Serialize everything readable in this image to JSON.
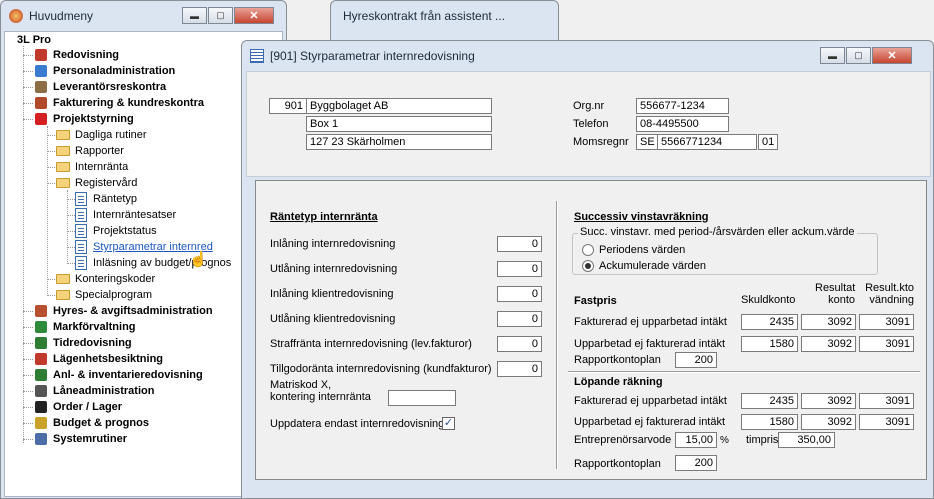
{
  "main_window": {
    "title": "Huvudmeny",
    "min": "▬",
    "max": "▢",
    "close": "✕"
  },
  "back_window": {
    "title": "Hyreskontrakt från assistent ..."
  },
  "tree": {
    "root": "3L Pro",
    "items": [
      {
        "label": "Redovisning",
        "icon": "book-icon",
        "color": "#c0392b"
      },
      {
        "label": "Personaladministration",
        "icon": "people-icon",
        "color": "#3b7ad1"
      },
      {
        "label": "Leverantörsreskontra",
        "icon": "box-icon",
        "color": "#8d6e46"
      },
      {
        "label": "Fakturering & kundreskontra",
        "icon": "cart-icon",
        "color": "#b04a2a"
      },
      {
        "label": "Projektstyrning",
        "icon": "binder-icon",
        "color": "#d42020"
      }
    ],
    "sub": [
      "Dagliga rutiner",
      "Rapporter",
      "Internränta",
      "Registervård"
    ],
    "leaf": [
      "Räntetyp",
      "Internräntesatser",
      "Projektstatus",
      "Styrparametrar internred",
      "Inläsning av budget/prognos"
    ],
    "sub2": [
      "Konteringskoder",
      "Specialprogram"
    ],
    "items2": [
      {
        "label": "Hyres- & avgiftsadministration",
        "icon": "house-icon",
        "color": "#b84f2e"
      },
      {
        "label": "Markförvaltning",
        "icon": "tree-icon",
        "color": "#2e8b3a"
      },
      {
        "label": "Tidredovisning",
        "icon": "clock-icon",
        "color": "#2e7d32"
      },
      {
        "label": "Lägenhetsbesiktning",
        "icon": "clipboard-icon",
        "color": "#c0392b"
      },
      {
        "label": "Anl- & inventarieredovisning",
        "icon": "chart-icon",
        "color": "#2e7d32"
      },
      {
        "label": "Låneadministration",
        "icon": "building-icon",
        "color": "#555"
      },
      {
        "label": "Order / Lager",
        "icon": "barcode-icon",
        "color": "#222"
      },
      {
        "label": "Budget & prognos",
        "icon": "coins-icon",
        "color": "#c9a227"
      },
      {
        "label": "Systemrutiner",
        "icon": "gear-icon",
        "color": "#4b6ea8"
      }
    ]
  },
  "dialog": {
    "title": "[901] Styrparametrar internredovisning",
    "company": {
      "nr": "901",
      "name": "Byggbolaget AB",
      "address": "Box 1",
      "city": "127 23  Skärholmen"
    },
    "org_label": "Org.nr",
    "org": "556677-1234",
    "tel_label": "Telefon",
    "tel": "08-4495500",
    "moms_label": "Momsregnr",
    "moms_cc": "SE",
    "moms_nr": "5566771234",
    "moms_suffix": "01",
    "left": {
      "heading": "Räntetyp internränta",
      "rows": [
        {
          "label": "Inlåning internredovisning",
          "value": "0"
        },
        {
          "label": "Utlåning internredovisning",
          "value": "0"
        },
        {
          "label": "Inlåning klientredovisning",
          "value": "0"
        },
        {
          "label": "Utlåning klientredovisning",
          "value": "0"
        },
        {
          "label": "Straffränta internredovisning (lev.fakturor)",
          "value": "0"
        },
        {
          "label": "Tillgodoränta internredovisning (kundfakturor)",
          "value": "0"
        }
      ],
      "matriskod_l1": "Matriskod X,",
      "matriskod_l2": "kontering internränta",
      "matriskod": "",
      "update_label": "Uppdatera endast internredovisning",
      "update_checked": "✓"
    },
    "right": {
      "heading": "Successiv vinstavräkning",
      "group_title": "Succ. vinstavr. med period-/årsvärden eller ackum.värde",
      "opt1": "Periodens värden",
      "opt2": "Ackumulerade värden",
      "selected": 2,
      "col1": "Skuldkonto",
      "col2a": "Resultat",
      "col2b": "konto",
      "col3a": "Result.kto",
      "col3b": "vändning",
      "fast_heading": "Fastpris",
      "fast_rows": [
        {
          "label": "Fakturerad ej upparbetad intäkt",
          "a": "2435",
          "b": "3092",
          "c": "3091"
        },
        {
          "label": "Upparbetad ej fakturerad intäkt",
          "a": "1580",
          "b": "3092",
          "c": "3091"
        }
      ],
      "rapport_label": "Rapportkontoplan",
      "rapport1": "200",
      "lop_heading": "Löpande räkning",
      "lop_rows": [
        {
          "label": "Fakturerad ej upparbetad intäkt",
          "a": "2435",
          "b": "3092",
          "c": "3091"
        },
        {
          "label": "Upparbetad ej fakturerad intäkt",
          "a": "1580",
          "b": "3092",
          "c": "3091"
        }
      ],
      "arvode_label": "Entreprenörsarvode",
      "arvode": "15,00",
      "pct": "%",
      "timpris_label": "timpris",
      "timpris": "350,00",
      "rapport2": "200"
    }
  }
}
